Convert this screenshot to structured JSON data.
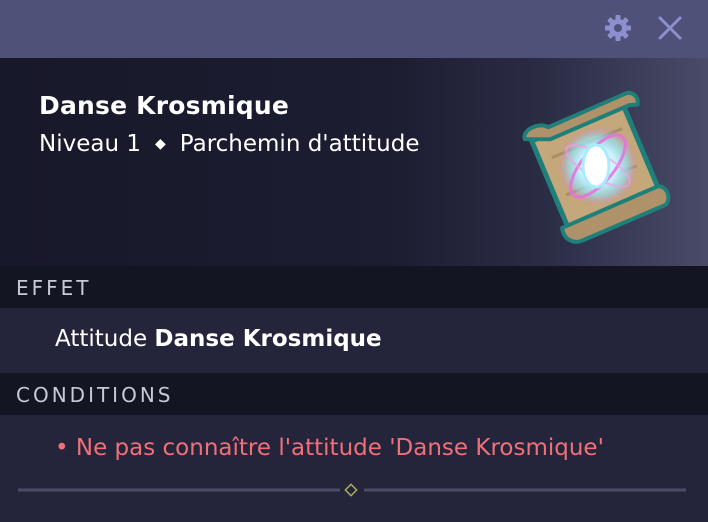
{
  "window": {
    "icons": [
      "gear-icon",
      "close-icon"
    ],
    "titlebar_color": "#505178"
  },
  "item": {
    "name": "Danse Krosmique",
    "level": "Niveau 1",
    "separator": "◆",
    "type": "Parchemin d'attitude",
    "image_icon": "attitude-scroll-icon"
  },
  "effect": {
    "heading": "EFFET",
    "prefix": "Attitude",
    "value": "Danse Krosmique"
  },
  "conditions": {
    "heading": "CONDITIONS",
    "items": [
      "• Ne pas connaître l'attitude 'Danse Krosmique'"
    ],
    "condition_color": "#f0707a"
  }
}
